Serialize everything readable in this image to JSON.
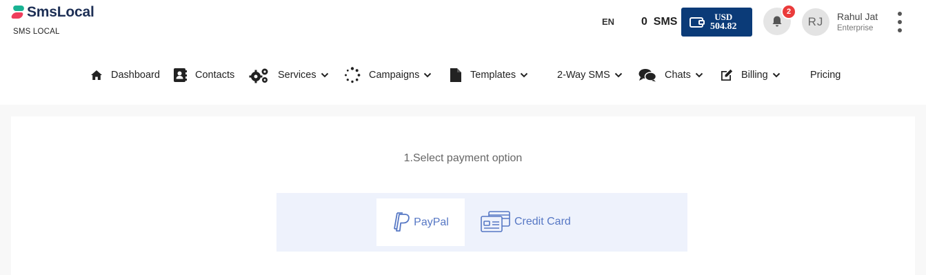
{
  "brand": {
    "name": "SmsLocal",
    "subtitle": "SMS LOCAL"
  },
  "header": {
    "language": "EN",
    "sms_count": "0",
    "sms_unit": "SMS",
    "wallet": {
      "currency": "USD",
      "amount": "504.82"
    },
    "notifications_badge": "2",
    "user": {
      "initials": "RJ",
      "name": "Rahul Jat",
      "role": "Enterprise"
    }
  },
  "nav": [
    {
      "label": "Dashboard",
      "icon": "home-icon"
    },
    {
      "label": "Contacts",
      "icon": "address-book-icon"
    },
    {
      "label": "Services",
      "icon": "gears-icon",
      "dropdown": true
    },
    {
      "label": "Campaigns",
      "icon": "spinner-icon",
      "dropdown": true
    },
    {
      "label": "Templates",
      "icon": "file-icon",
      "dropdown": true
    },
    {
      "label": "2-Way SMS",
      "dropdown": true
    },
    {
      "label": "Chats",
      "icon": "chat-bubbles-icon",
      "dropdown": true
    },
    {
      "label": "Billing",
      "icon": "edit-icon",
      "dropdown": true
    },
    {
      "label": "Pricing"
    }
  ],
  "payment": {
    "step_title": "1.Select payment option",
    "options": [
      {
        "label": "PayPal",
        "icon": "paypal-icon",
        "selected": true
      },
      {
        "label": "Credit Card",
        "icon": "credit-card-icon",
        "selected": false
      }
    ]
  },
  "colors": {
    "brand_navy": "#1d2f55",
    "wallet_bg": "#0b3b78",
    "badge_red": "#ea3b3b",
    "payment_accent": "#5677c4",
    "payment_panel_bg": "#eef2fc"
  }
}
